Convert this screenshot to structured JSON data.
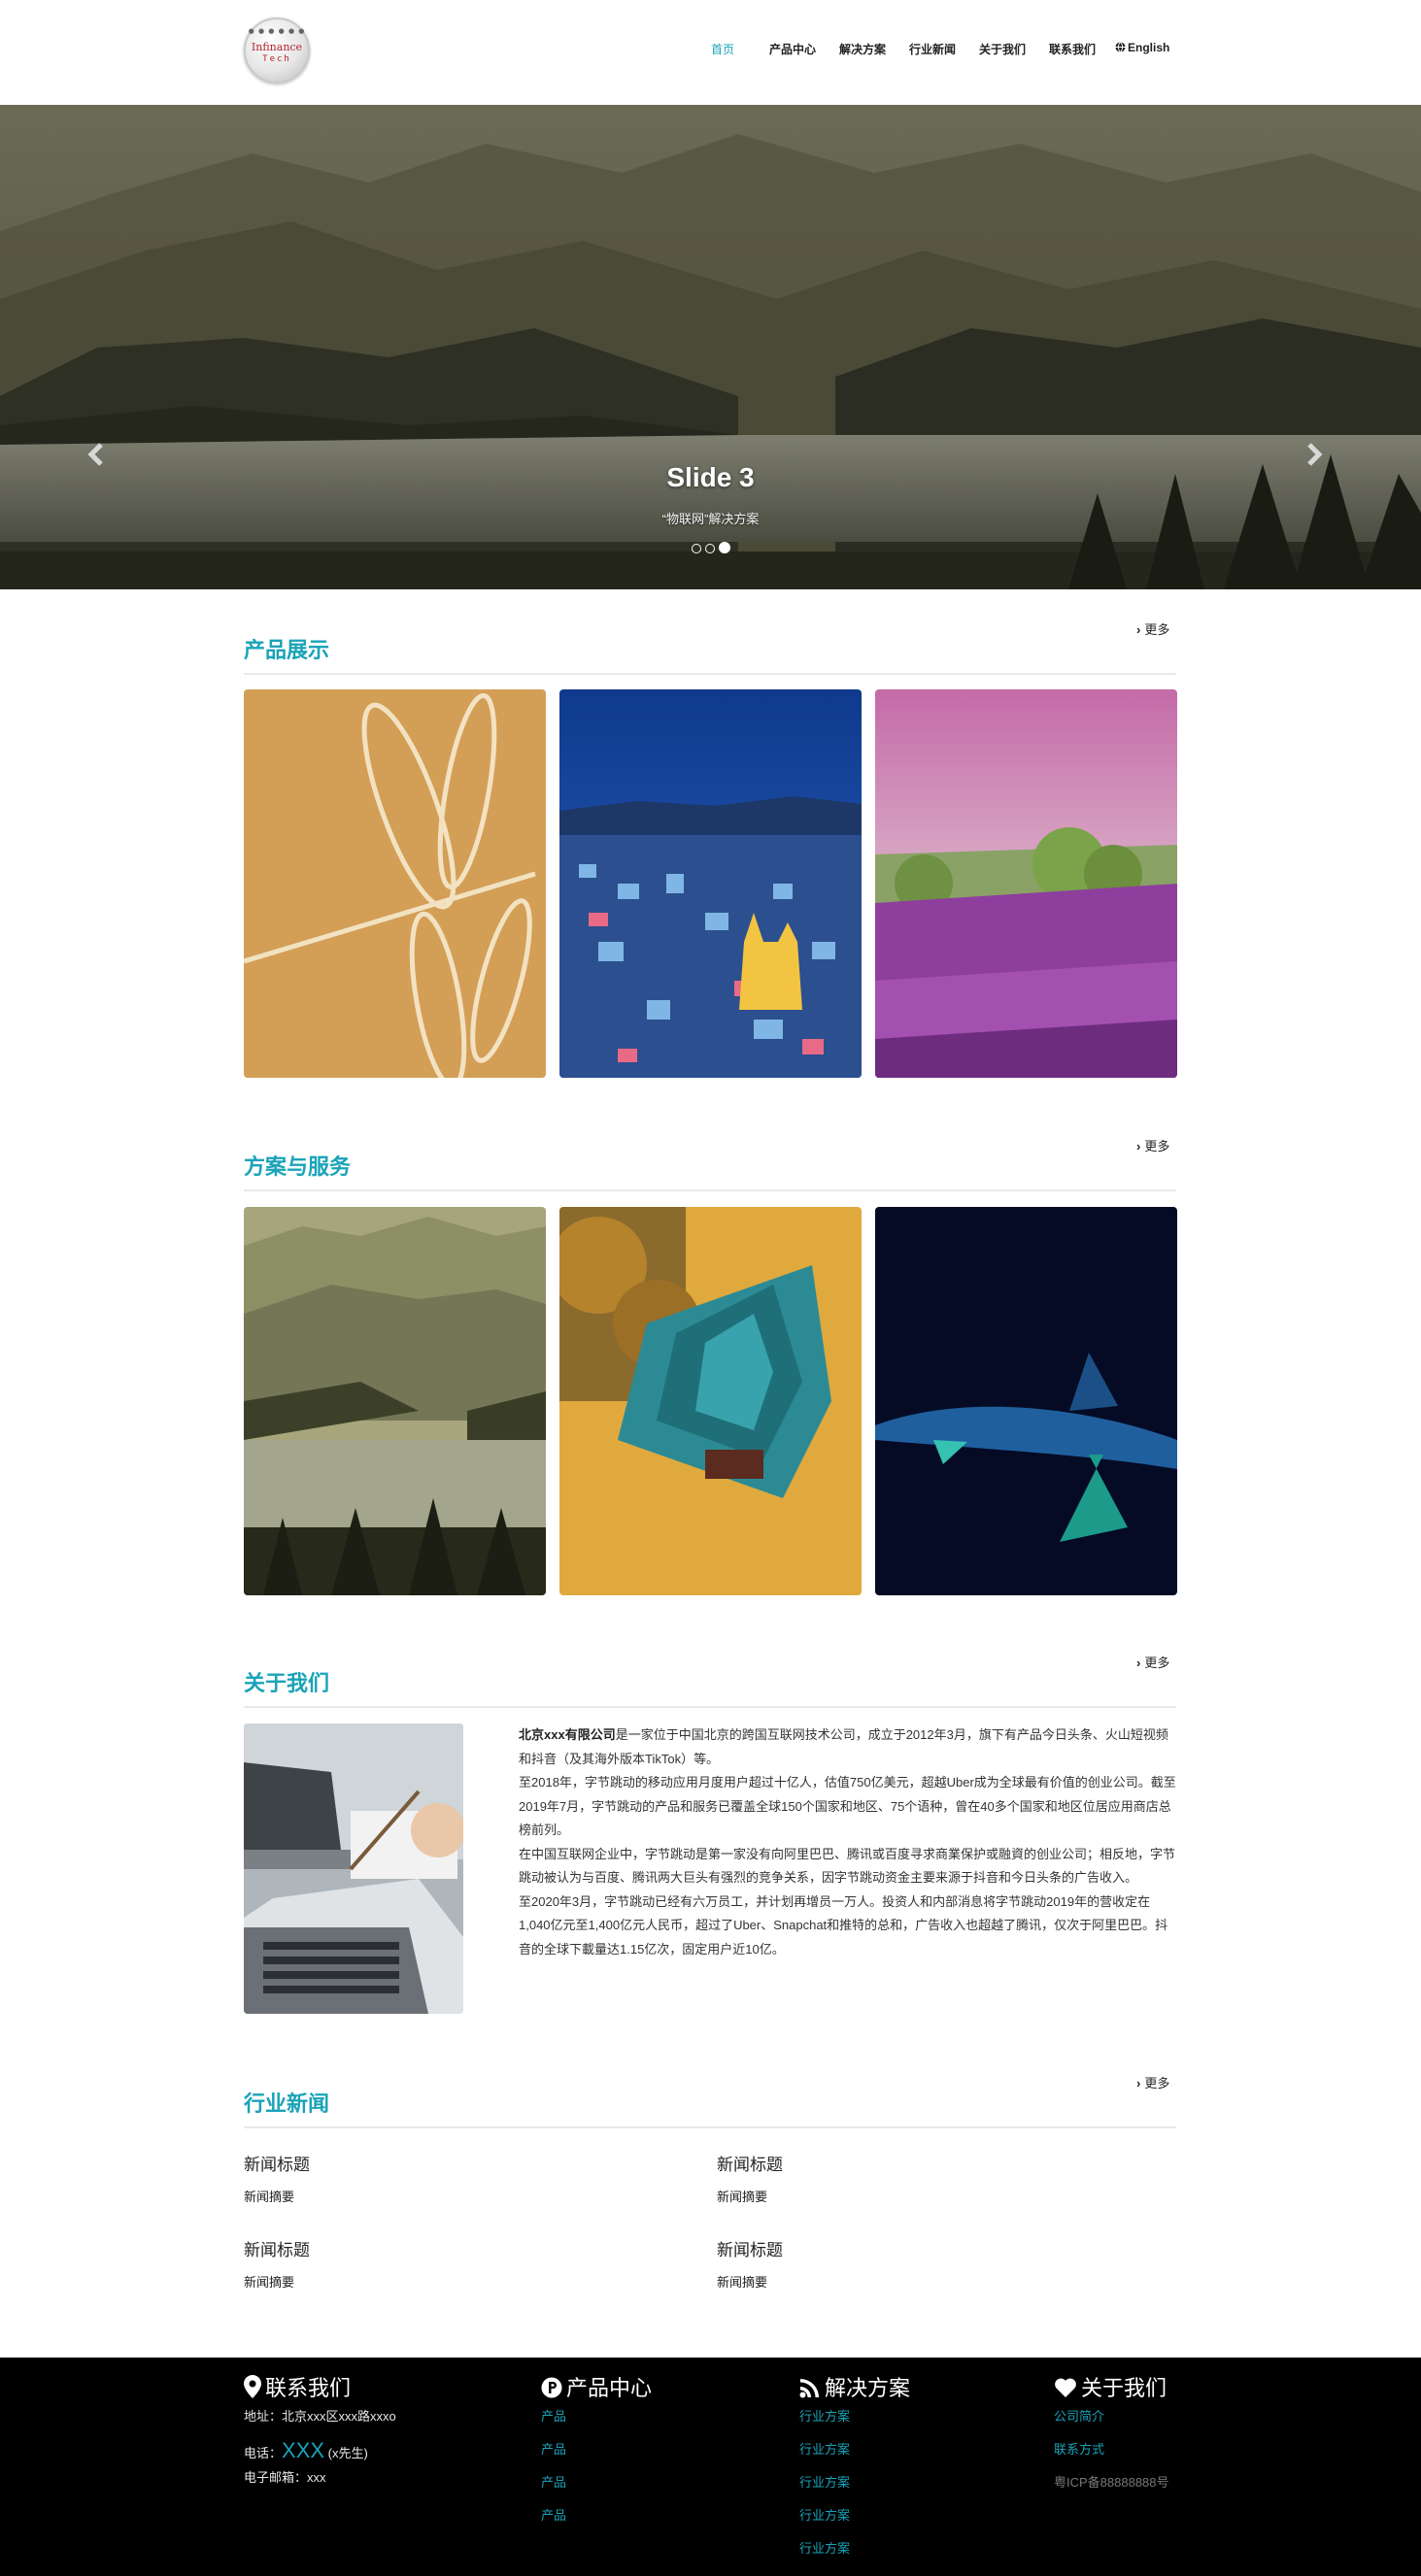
{
  "header": {
    "logo": {
      "dots_text": "● ● ● ● ● ●",
      "line1": "Infinance",
      "line2": "Tech"
    },
    "nav": [
      "首页",
      "产品中心",
      "解决方案",
      "行业新闻",
      "关于我们",
      "联系我们",
      "English"
    ]
  },
  "carousel": {
    "title": "Slide 3",
    "caption": "“物联网”解决方案",
    "active_index": 2,
    "slide_count": 3
  },
  "products": {
    "title": "产品展示",
    "more": "更多"
  },
  "solutions": {
    "title": "方案与服务",
    "more": "更多"
  },
  "about": {
    "title": "关于我们",
    "more": "更多",
    "company": "北京xxx有限公司",
    "p1_rest": "是一家位于中国北京的跨国互联网技术公司，成立于2012年3月，旗下有产品今日头条、火山短视频和抖音（及其海外版本TikTok）等。",
    "p2": "至2018年，字节跳动的移动应用月度用户超过十亿人，估值750亿美元，超越Uber成为全球最有价值的创业公司。截至2019年7月，字节跳动的产品和服务已覆盖全球150个国家和地区、75个语种，曾在40多个国家和地区位居应用商店总榜前列。",
    "p3": "在中国互联网企业中，字节跳动是第一家没有向阿里巴巴、腾讯或百度寻求商業保护或融資的创业公司；相反地，字节跳动被认为与百度、腾讯两大巨头有强烈的竞争关系，因字节跳动资金主要来源于抖音和今日头条的广告收入。",
    "p4": "至2020年3月，字节跳动已经有六万员工，并计划再增员一万人。投资人和内部消息将字节跳动2019年的营收定在1,040亿元至1,400亿元人民币，超过了Uber、Snapchat和推特的总和，广告收入也超越了腾讯，仅次于阿里巴巴。抖音的全球下載量达1.15亿次，固定用户近10亿。"
  },
  "news": {
    "title": "行业新闻",
    "more": "更多",
    "items": [
      {
        "title": "新闻标题",
        "summary": "新闻摘要"
      },
      {
        "title": "新闻标题",
        "summary": "新闻摘要"
      },
      {
        "title": "新闻标题",
        "summary": "新闻摘要"
      },
      {
        "title": "新闻标题",
        "summary": "新闻摘要"
      }
    ]
  },
  "footer": {
    "contact": {
      "title": "联系我们",
      "address": "地址：北京xxx区xxx路xxxo",
      "phone_label": "电话：",
      "phone": "XXX",
      "phone_person": "(x先生)",
      "email": "电子邮箱：xxx"
    },
    "products": {
      "title": "产品中心",
      "links": [
        "产品",
        "产品",
        "产品",
        "产品"
      ]
    },
    "solutions": {
      "title": "解决方案",
      "links": [
        "行业方案",
        "行业方案",
        "行业方案",
        "行业方案",
        "行业方案"
      ]
    },
    "about": {
      "title": "关于我们",
      "links": [
        "公司简介",
        "联系方式"
      ],
      "icp": "粤ICP备88888888号"
    }
  },
  "colors": {
    "accent": "#1aa3b8",
    "footer_bg": "#000000"
  }
}
